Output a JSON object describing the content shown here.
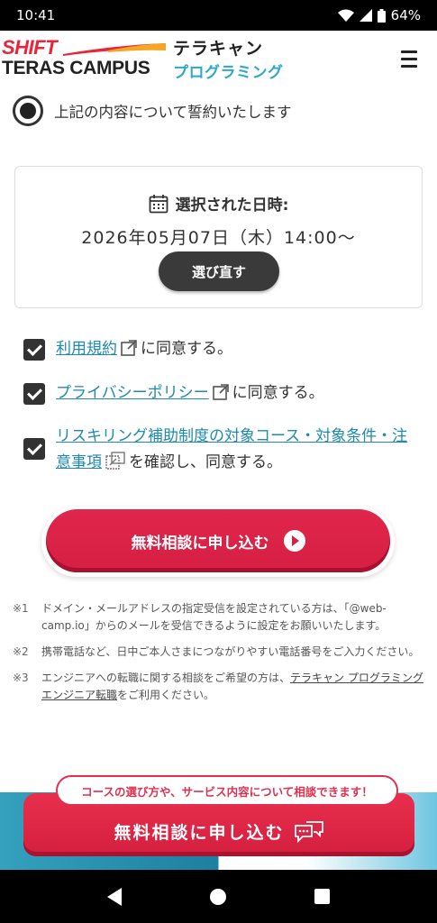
{
  "status": {
    "time": "10:41",
    "battery": "64%"
  },
  "header": {
    "logo_shift": "SHIFT",
    "logo_teras": "TERAS CAMPUS",
    "logo_terakyan": "テラキャン",
    "logo_programming": "プログラミング"
  },
  "pledge": {
    "label": "上記の内容について誓約いたします",
    "checked": true
  },
  "selected_date": {
    "title": "選択された日時:",
    "value": "2026年05月07日（木）14:00〜",
    "reselect_label": "選び直す"
  },
  "agreements": [
    {
      "link": "利用規約",
      "suffix": "に同意する。",
      "checked": true
    },
    {
      "link": "プライバシーポリシー",
      "suffix": "に同意する。",
      "checked": true
    },
    {
      "link": "リスキリング補助制度の対象コース・対象条件・注意事項",
      "suffix": "を確認し、同意する。",
      "checked": true
    }
  ],
  "cta": {
    "label": "無料相談に申し込む"
  },
  "notes": [
    {
      "mark": "※1",
      "text": "ドメイン・メールアドレスの指定受信を設定されている方は、「@web-camp.io」からのメールを受信できるように設定をお願いいたします。"
    },
    {
      "mark": "※2",
      "text": "携帯電話など、日中ご本人さまにつながりやすい電話番号をご入力ください。"
    },
    {
      "mark": "※3",
      "text_before": "エンジニアへの転職に関する相談をご希望の方は、",
      "link": "テラキャン プログラミング エンジニア転職",
      "text_after": "をご利用ください。"
    }
  ],
  "bottom_cta": {
    "pill": "コースの選び方や、サービス内容について相談できます！",
    "label": "無料相談に申し込む"
  },
  "colors": {
    "accent": "#d61f44",
    "link": "#1d8ab0",
    "brand_blue": "#2fa8c8"
  }
}
